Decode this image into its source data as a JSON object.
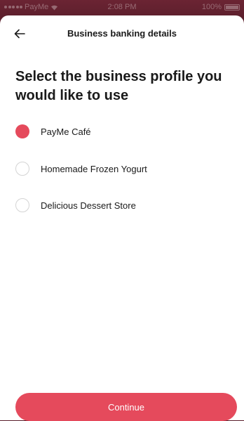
{
  "status_bar": {
    "carrier": "PayMe",
    "time": "2:08 PM",
    "battery_percent": "100%",
    "battery_level": 1.0
  },
  "header": {
    "title": "Business banking details"
  },
  "page": {
    "title": "Select the business profile you would like to use"
  },
  "options": [
    {
      "label": "PayMe Café",
      "selected": true
    },
    {
      "label": "Homemade Frozen Yogurt",
      "selected": false
    },
    {
      "label": "Delicious Dessert Store",
      "selected": false
    }
  ],
  "actions": {
    "continue_label": "Continue"
  },
  "colors": {
    "accent": "#e54a5c",
    "status_bar": "#5c1f2c"
  },
  "icons": {
    "back": "arrow-left-icon",
    "wifi": "wifi-icon",
    "battery": "battery-icon"
  }
}
